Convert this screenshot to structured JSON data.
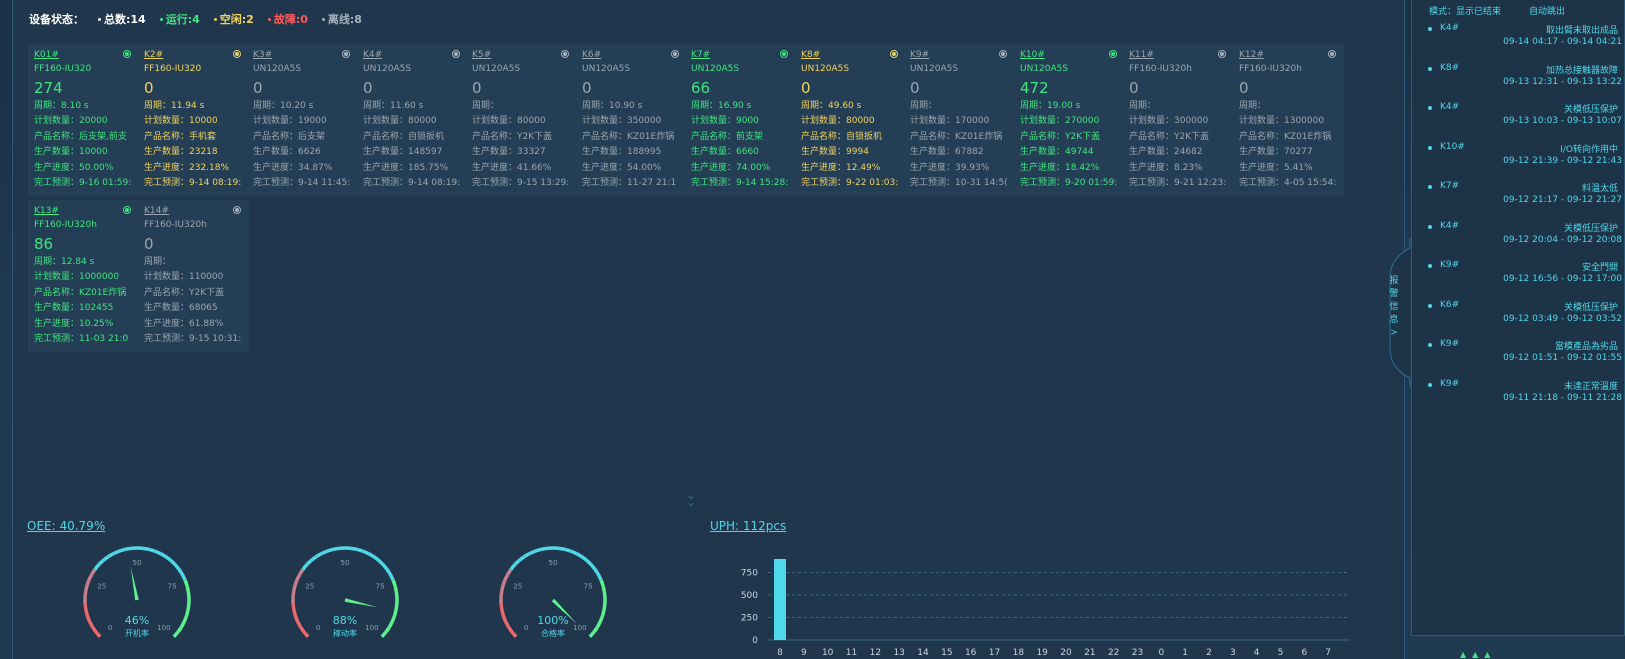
{
  "status": {
    "label": "设备状态：",
    "total": "总数:14",
    "running": "运行:4",
    "idle": "空闲:2",
    "fault": "故障:0",
    "offline": "离线:8"
  },
  "machines": [
    {
      "id": "K01#",
      "state": "run",
      "model": "FF160-IU320",
      "count": "274",
      "cycle": "周期：8.10 s",
      "plan": "计划数量：20000",
      "product": "产品名称：后支架,前支",
      "produced": "生产数量：10000",
      "progress": "生产进度：50.00%",
      "eta": "完工预测：9-16 01:59:"
    },
    {
      "id": "K2#",
      "state": "idle",
      "model": "FF160-IU320",
      "count": "0",
      "cycle": "周期：11.94 s",
      "plan": "计划数量：10000",
      "product": "产品名称：手机套",
      "produced": "生产数量：23218",
      "progress": "生产进度：232.18%",
      "eta": "完工预测：9-14 08:19:"
    },
    {
      "id": "K3#",
      "state": "off",
      "model": "UN120A5S",
      "count": "0",
      "cycle": "周期：10.20 s",
      "plan": "计划数量：19000",
      "product": "产品名称：后支架",
      "produced": "生产数量：6626",
      "progress": "生产进度：34.87%",
      "eta": "完工预测：9-14 11:45:"
    },
    {
      "id": "K4#",
      "state": "off",
      "model": "UN120A5S",
      "count": "0",
      "cycle": "周期：11.60 s",
      "plan": "计划数量：80000",
      "product": "产品名称：自锁扳机",
      "produced": "生产数量：148597",
      "progress": "生产进度：185.75%",
      "eta": "完工预测：9-14 08:19:"
    },
    {
      "id": "K5#",
      "state": "off",
      "model": "UN120A5S",
      "count": "0",
      "cycle": "周期：",
      "plan": "计划数量：80000",
      "product": "产品名称：Y2K下盖",
      "produced": "生产数量：33327",
      "progress": "生产进度：41.66%",
      "eta": "完工预测：9-15 13:29:"
    },
    {
      "id": "K6#",
      "state": "off",
      "model": "UN120A5S",
      "count": "0",
      "cycle": "周期：10.90 s",
      "plan": "计划数量：350000",
      "product": "产品名称：KZ01E炸锅",
      "produced": "生产数量：188995",
      "progress": "生产进度：54.00%",
      "eta": "完工预测：11-27 21:1"
    },
    {
      "id": "K7#",
      "state": "run",
      "model": "UN120A5S",
      "count": "66",
      "cycle": "周期：16.90 s",
      "plan": "计划数量：9000",
      "product": "产品名称：前支架",
      "produced": "生产数量：6660",
      "progress": "生产进度：74.00%",
      "eta": "完工预测：9-14 15:28:"
    },
    {
      "id": "K8#",
      "state": "idle",
      "model": "UN120A5S",
      "count": "0",
      "cycle": "周期：49.60 s",
      "plan": "计划数量：80000",
      "product": "产品名称：自锁扳机",
      "produced": "生产数量：9994",
      "progress": "生产进度：12.49%",
      "eta": "完工预测：9-22 01:03:"
    },
    {
      "id": "K9#",
      "state": "off",
      "model": "UN120A5S",
      "count": "0",
      "cycle": "周期：",
      "plan": "计划数量：170000",
      "product": "产品名称：KZ01E炸锅",
      "produced": "生产数量：67882",
      "progress": "生产进度：39.93%",
      "eta": "完工预测：10-31 14:5("
    },
    {
      "id": "K10#",
      "state": "run",
      "model": "UN120A5S",
      "count": "472",
      "cycle": "周期：19.00 s",
      "plan": "计划数量：270000",
      "product": "产品名称：Y2K下盖",
      "produced": "生产数量：49744",
      "progress": "生产进度：18.42%",
      "eta": "完工预测：9-20 01:59:"
    },
    {
      "id": "K11#",
      "state": "off",
      "model": "FF160-IU320h",
      "count": "0",
      "cycle": "周期：",
      "plan": "计划数量：300000",
      "product": "产品名称：Y2K下盖",
      "produced": "生产数量：24682",
      "progress": "生产进度：8.23%",
      "eta": "完工预测：9-21 12:23:"
    },
    {
      "id": "K12#",
      "state": "off",
      "model": "FF160-IU320h",
      "count": "0",
      "cycle": "周期：",
      "plan": "计划数量：1300000",
      "product": "产品名称：KZ01E炸锅",
      "produced": "生产数量：70277",
      "progress": "生产进度：5.41%",
      "eta": "完工预测：4-05 15:54:"
    },
    {
      "id": "K13#",
      "state": "run",
      "model": "FF160-IU320h",
      "count": "86",
      "cycle": "周期：12.84 s",
      "plan": "计划数量：1000000",
      "product": "产品名称：KZ01E炸锅",
      "produced": "生产数量：102455",
      "progress": "生产进度：10.25%",
      "eta": "完工预测：11-03 21:0"
    },
    {
      "id": "K14#",
      "state": "off",
      "model": "FF160-IU320h",
      "count": "0",
      "cycle": "周期：",
      "plan": "计划数量：110000",
      "product": "产品名称：Y2K下盖",
      "produced": "生产数量：68065",
      "progress": "生产进度：61.88%",
      "eta": "完工预测：9-15 10:31:"
    }
  ],
  "oee": {
    "title": "OEE: 40.79%",
    "gauges": [
      {
        "value": 46,
        "label": "开机率",
        "display": "46%"
      },
      {
        "value": 88,
        "label": "稼动率",
        "display": "88%"
      },
      {
        "value": 100,
        "label": "合格率",
        "display": "100%"
      }
    ],
    "ticks": [
      "0",
      "25",
      "50",
      "75",
      "100"
    ]
  },
  "chart_data": {
    "type": "bar",
    "title": "UPH: 112pcs",
    "categories": [
      "8",
      "9",
      "10",
      "11",
      "12",
      "13",
      "14",
      "15",
      "16",
      "17",
      "18",
      "19",
      "20",
      "21",
      "22",
      "23",
      "0",
      "1",
      "2",
      "3",
      "4",
      "5",
      "6",
      "7"
    ],
    "values": [
      900,
      0,
      0,
      0,
      0,
      0,
      0,
      0,
      0,
      0,
      0,
      0,
      0,
      0,
      0,
      0,
      0,
      0,
      0,
      0,
      0,
      0,
      0,
      0
    ],
    "yticks": [
      "0",
      "250",
      "500",
      "750"
    ],
    "ylim": [
      0,
      1000
    ],
    "grid": true,
    "color": "#4fd8e8"
  },
  "sidebar": {
    "mode_label": "模式：显示已结束",
    "auto_label": "自动跳出",
    "tab_label": "报警信息",
    "tab_arrow": ">",
    "alarms": [
      {
        "machine": "K4#",
        "msg": "取出臂未取出成品",
        "time": "09-14 04:17 - 09-14 04:21"
      },
      {
        "machine": "K8#",
        "msg": "加热总接触器故障",
        "time": "09-13 12:31 - 09-13 13:22"
      },
      {
        "machine": "K4#",
        "msg": "关模低压保护",
        "time": "09-13 10:03 - 09-13 10:07"
      },
      {
        "machine": "K10#",
        "msg": "I/O转向作用中",
        "time": "09-12 21:39 - 09-12 21:43"
      },
      {
        "machine": "K7#",
        "msg": "料温太低",
        "time": "09-12 21:17 - 09-12 21:27"
      },
      {
        "machine": "K4#",
        "msg": "关模低压保护",
        "time": "09-12 20:04 - 09-12 20:08"
      },
      {
        "machine": "K9#",
        "msg": "安全門開",
        "time": "09-12 16:56 - 09-12 17:00"
      },
      {
        "machine": "K6#",
        "msg": "关模低压保护",
        "time": "09-12 03:49 - 09-12 03:52"
      },
      {
        "machine": "K9#",
        "msg": "當模產品為劣品",
        "time": "09-12 01:51 - 09-12 01:55"
      },
      {
        "machine": "K9#",
        "msg": "未達正常溫度",
        "time": "09-11 21:18 - 09-11 21:28"
      }
    ]
  },
  "colors": {
    "run": "#3ee67f",
    "idle": "#f0d35f",
    "fault": "#ff5b5b",
    "off": "#a7b2bc",
    "accent": "#4fd8e8"
  }
}
